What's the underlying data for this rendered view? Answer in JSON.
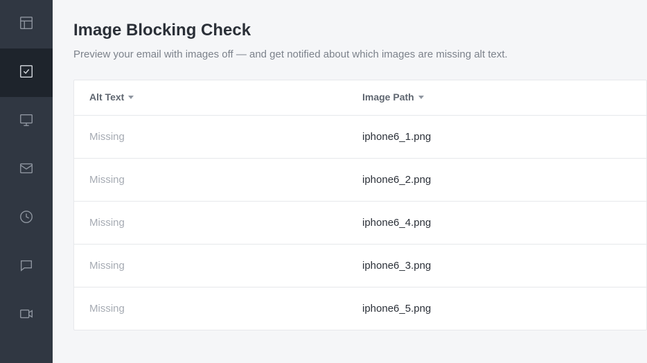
{
  "sidebar": {
    "items": [
      {
        "name": "layout"
      },
      {
        "name": "checklist",
        "active": true
      },
      {
        "name": "desktop"
      },
      {
        "name": "mail"
      },
      {
        "name": "analytics"
      },
      {
        "name": "comments"
      },
      {
        "name": "video"
      }
    ]
  },
  "header": {
    "title": "Image Blocking Check",
    "subtitle": "Preview your email with images off — and get notified about which images are missing alt text."
  },
  "table": {
    "columns": {
      "alt": "Alt Text",
      "path": "Image Path"
    },
    "rows": [
      {
        "alt": "Missing",
        "path": "iphone6_1.png"
      },
      {
        "alt": "Missing",
        "path": "iphone6_2.png"
      },
      {
        "alt": "Missing",
        "path": "iphone6_4.png"
      },
      {
        "alt": "Missing",
        "path": "iphone6_3.png"
      },
      {
        "alt": "Missing",
        "path": "iphone6_5.png"
      }
    ]
  }
}
